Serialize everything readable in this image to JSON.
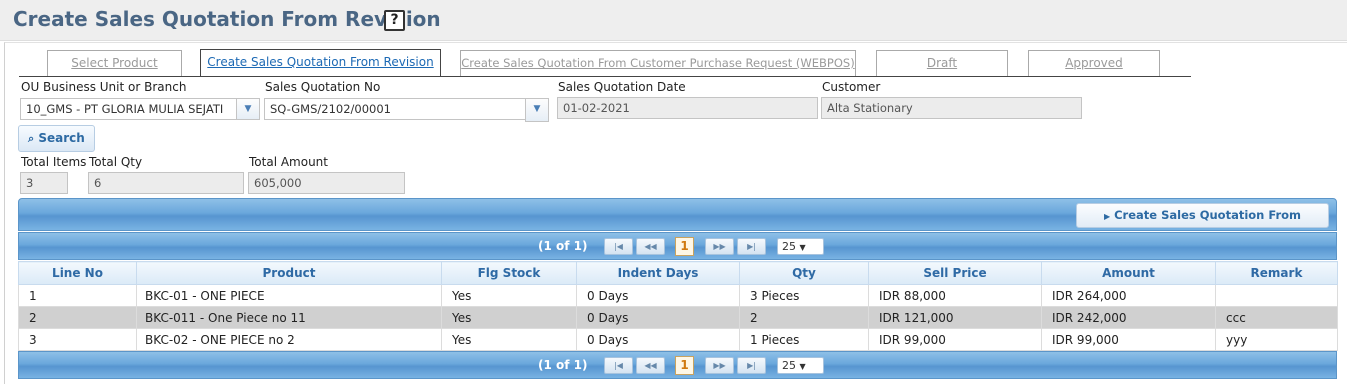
{
  "page": {
    "title": "Create Sales Quotation From Revision",
    "help_label": "?"
  },
  "tabs": [
    {
      "label": "Select Product",
      "active": false
    },
    {
      "label": "Create Sales Quotation From Revision",
      "active": true
    },
    {
      "label": "Create Sales Quotation From Customer Purchase Request (WEBPOS)",
      "active": false
    },
    {
      "label": "Draft",
      "active": false
    },
    {
      "label": "Approved",
      "active": false
    }
  ],
  "form": {
    "ou_label": "OU Business Unit or Branch",
    "ou_value": "10_GMS - PT GLORIA MULIA SEJATI",
    "sq_no_label": "Sales Quotation No",
    "sq_no_value": "SQ-GMS/2102/00001",
    "sq_date_label": "Sales Quotation Date",
    "sq_date_value": "01-02-2021",
    "customer_label": "Customer",
    "customer_value": "Alta Stationary",
    "search_label": "Search"
  },
  "totals": {
    "items_label": "Total Items",
    "items_value": "3",
    "qty_label": "Total Qty",
    "qty_value": "6",
    "amount_label": "Total Amount",
    "amount_value": "605,000"
  },
  "grid": {
    "create_button_label": "Create Sales Quotation From Revision",
    "pager_info": "(1 of 1)",
    "current_page": "1",
    "page_size": "25",
    "columns": [
      "Line No",
      "Product",
      "Flg Stock",
      "Indent Days",
      "Qty",
      "Sell Price",
      "Amount",
      "Remark"
    ],
    "rows": [
      {
        "line": "1",
        "product": "BKC-01 - ONE PIECE",
        "stock": "Yes",
        "indent": "0 Days",
        "qty": "3  Pieces",
        "price": "IDR  88,000",
        "amount": "IDR  264,000",
        "remark": ""
      },
      {
        "line": "2",
        "product": "BKC-011 - One Piece no 11",
        "stock": "Yes",
        "indent": "0 Days",
        "qty": "2",
        "price": "IDR  121,000",
        "amount": "IDR  242,000",
        "remark": "ccc"
      },
      {
        "line": "3",
        "product": "BKC-02 - ONE PIECE no 2",
        "stock": "Yes",
        "indent": "0 Days",
        "qty": "1  Pieces",
        "price": "IDR  99,000",
        "amount": "IDR  99,000",
        "remark": "yyy"
      }
    ]
  }
}
